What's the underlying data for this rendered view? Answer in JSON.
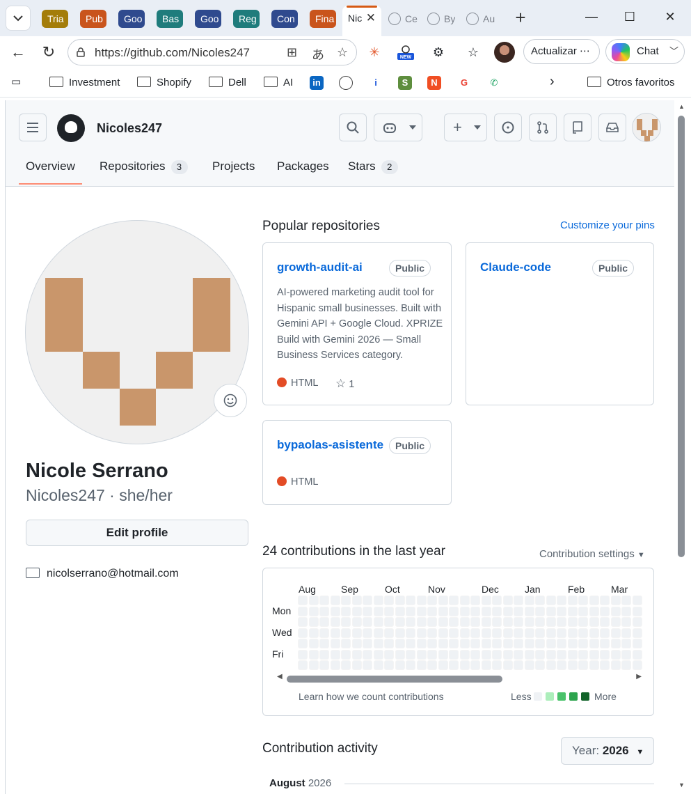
{
  "browser": {
    "tabs": [
      {
        "label": "Tria",
        "color": "#a47d0a"
      },
      {
        "label": "Pub",
        "color": "#c9541c"
      },
      {
        "label": "Goo",
        "color": "#2f4a8e"
      },
      {
        "label": "Bas",
        "color": "#1f7c7c"
      },
      {
        "label": "Goo",
        "color": "#2f4a8e"
      },
      {
        "label": "Reg",
        "color": "#1f7c7c"
      },
      {
        "label": "Con",
        "color": "#2f4a8e"
      },
      {
        "label": "Fina",
        "color": "#c9541c"
      }
    ],
    "active_tab": "Nic",
    "globe_tabs": [
      "Ce",
      "By",
      "Au"
    ],
    "url": "https://github.com/Nicoles247",
    "update_label": "Actualizar",
    "chat_label": "Chat",
    "new_badge": "NEW",
    "bookmarks": [
      "Investment",
      "Shopify",
      "Dell",
      "AI"
    ],
    "other_favorites": "Otros favoritos"
  },
  "header": {
    "username": "Nicoles247",
    "tabs": [
      {
        "label": "Overview",
        "count": ""
      },
      {
        "label": "Repositories",
        "count": "3"
      },
      {
        "label": "Projects",
        "count": ""
      },
      {
        "label": "Packages",
        "count": ""
      },
      {
        "label": "Stars",
        "count": "2"
      }
    ]
  },
  "profile": {
    "name": "Nicole Serrano",
    "login": "Nicoles247 · she/her",
    "edit_label": "Edit profile",
    "email": "nicolserrano@hotmail.com"
  },
  "popular": {
    "title": "Popular repositories",
    "customize": "Customize your pins",
    "repos": [
      {
        "name": "growth-audit-ai",
        "visibility": "Public",
        "description": "AI-powered marketing audit tool for Hispanic small businesses. Built with Gemini API + Google Cloud. XPRIZE Build with Gemini 2026 — Small Business Services category.",
        "language": "HTML",
        "lang_color": "#e34c26",
        "stars": "1"
      },
      {
        "name": "Claude-code",
        "visibility": "Public",
        "description": "",
        "language": "",
        "lang_color": "",
        "stars": ""
      },
      {
        "name": "bypaolas-asistente",
        "visibility": "Public",
        "description": "",
        "language": "HTML",
        "lang_color": "#e34c26",
        "stars": ""
      }
    ]
  },
  "contributions": {
    "title": "24 contributions in the last year",
    "settings": "Contribution settings",
    "months": [
      "Aug",
      "Sep",
      "Oct",
      "Nov",
      "Dec",
      "Jan",
      "Feb",
      "Mar"
    ],
    "days": [
      "Mon",
      "Wed",
      "Fri"
    ],
    "learn": "Learn how we count contributions",
    "less": "Less",
    "more": "More",
    "legend_colors": [
      "#eff2f5",
      "#aceebb",
      "#4ac26b",
      "#2da44e",
      "#116329"
    ]
  },
  "activity": {
    "title": "Contribution activity",
    "year_label": "Year:",
    "year": "2026",
    "month": "August",
    "month_year": "2026"
  }
}
